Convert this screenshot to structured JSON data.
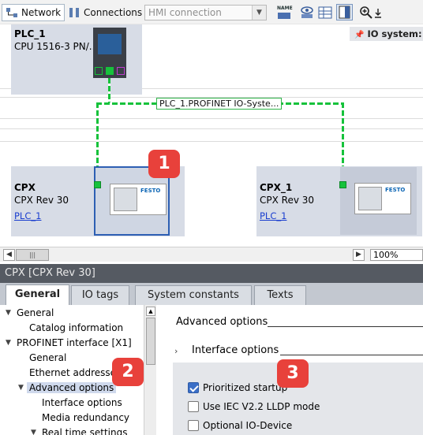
{
  "toolbar": {
    "network_label": "Network",
    "connections_label": "Connections",
    "connection_dropdown_value": "HMI connection",
    "name_icon_text": "NAME"
  },
  "canvas": {
    "io_system_label": "IO system: P",
    "network_label": "PLC_1.PROFINET IO-Syste...",
    "plc": {
      "name": "PLC_1",
      "type": "CPU 1516-3 PN/..."
    },
    "devices": [
      {
        "name": "CPX",
        "type": "CPX Rev 30",
        "link": "PLC_1"
      },
      {
        "name": "CPX_1",
        "type": "CPX Rev 30",
        "link": "PLC_1"
      }
    ],
    "device_brand": "FESTO",
    "zoom": "100%"
  },
  "properties": {
    "title": "CPX [CPX Rev 30]",
    "tabs": [
      {
        "label": "General",
        "active": true
      },
      {
        "label": "IO tags",
        "active": false
      },
      {
        "label": "System constants",
        "active": false
      },
      {
        "label": "Texts",
        "active": false
      }
    ],
    "nav": [
      "General",
      "Catalog information",
      "PROFINET interface [X1]",
      "General",
      "Ethernet addresses",
      "Advanced options",
      "Interface options",
      "Media redundancy",
      "Real time settings"
    ],
    "content": {
      "section": "Advanced options",
      "subsection": "Interface options",
      "options": [
        {
          "label": "Prioritized startup",
          "checked": true
        },
        {
          "label": "Use IEC V2.2 LLDP mode",
          "checked": false
        },
        {
          "label": "Optional IO-Device",
          "checked": false
        }
      ]
    }
  },
  "badges": [
    "1",
    "2",
    "3"
  ],
  "colors": {
    "network_green": "#16c23b",
    "badge_red": "#e8413b",
    "selection_blue": "#2d5fb3",
    "device_gray": "#d7dce6"
  }
}
